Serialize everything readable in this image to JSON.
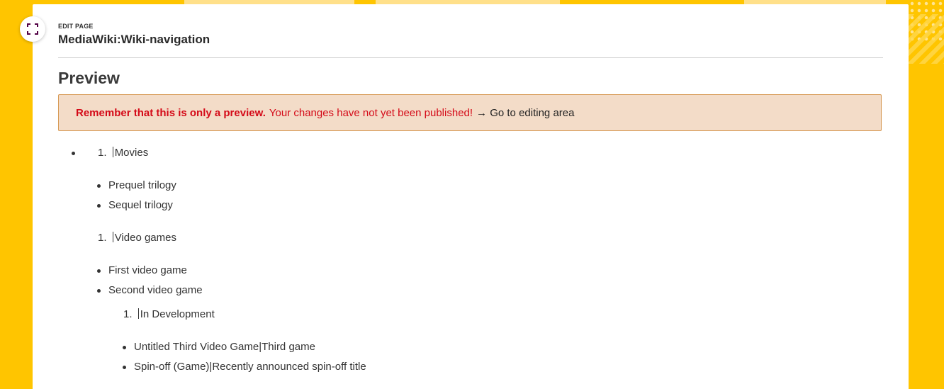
{
  "header": {
    "edit_label": "EDIT PAGE",
    "page_title": "MediaWiki:Wiki-navigation"
  },
  "preview": {
    "heading": "Preview",
    "notice_strong": "Remember that this is only a preview.",
    "notice_message": "Your changes have not yet been published!",
    "notice_link": "→ Go to editing area"
  },
  "content": {
    "section1_number": "1.",
    "section1_title": "Movies",
    "movies": [
      "Prequel trilogy",
      "Sequel trilogy"
    ],
    "section2_number": "1.",
    "section2_title": "Video games",
    "games": [
      "First video game",
      "Second video game"
    ],
    "section3_number": "1.",
    "section3_title": "In Development",
    "in_development": [
      "Untitled Third Video Game|Third game",
      "Spin-off (Game)|Recently announced spin-off title"
    ]
  },
  "colors": {
    "background": "#ffc500",
    "notice_bg": "#f3dcc8",
    "notice_border": "#d79a55",
    "warning_text": "#d40a18"
  },
  "icons": {
    "fullscreen": "expand-icon"
  }
}
